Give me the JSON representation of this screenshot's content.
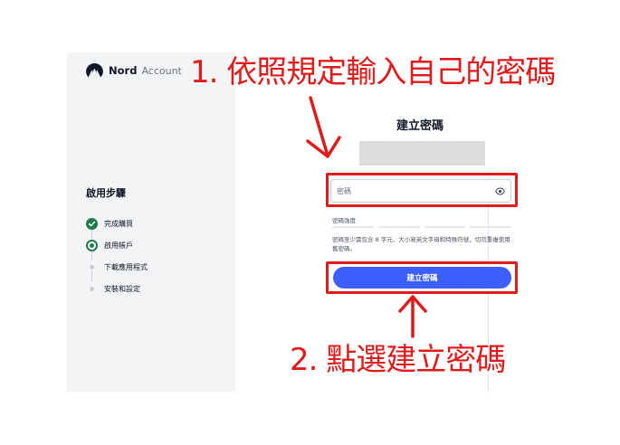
{
  "brand": {
    "name": "Nord",
    "suffix": "Account"
  },
  "sidebar": {
    "title": "啟用步驟",
    "steps": [
      {
        "label": "完成購買",
        "state": "done"
      },
      {
        "label": "啟用帳戶",
        "state": "active"
      },
      {
        "label": "下載應用程式",
        "state": "pending"
      },
      {
        "label": "安裝和設定",
        "state": "pending"
      }
    ]
  },
  "form": {
    "title": "建立密碼",
    "password_placeholder": "密碼",
    "strength_label": "密碼強度",
    "hint": "密碼至少需包含 8 字元、大小寫英文字母和特殊符號，切勿重複使用舊密碼。",
    "submit_label": "建立密碼"
  },
  "annotations": {
    "step1": "1. 依照規定輸入自己的密碼",
    "step2": "2. 點選建立密碼"
  },
  "colors": {
    "accent": "#3e5fff",
    "success": "#1f7a4c",
    "highlight": "#e01b1b"
  }
}
